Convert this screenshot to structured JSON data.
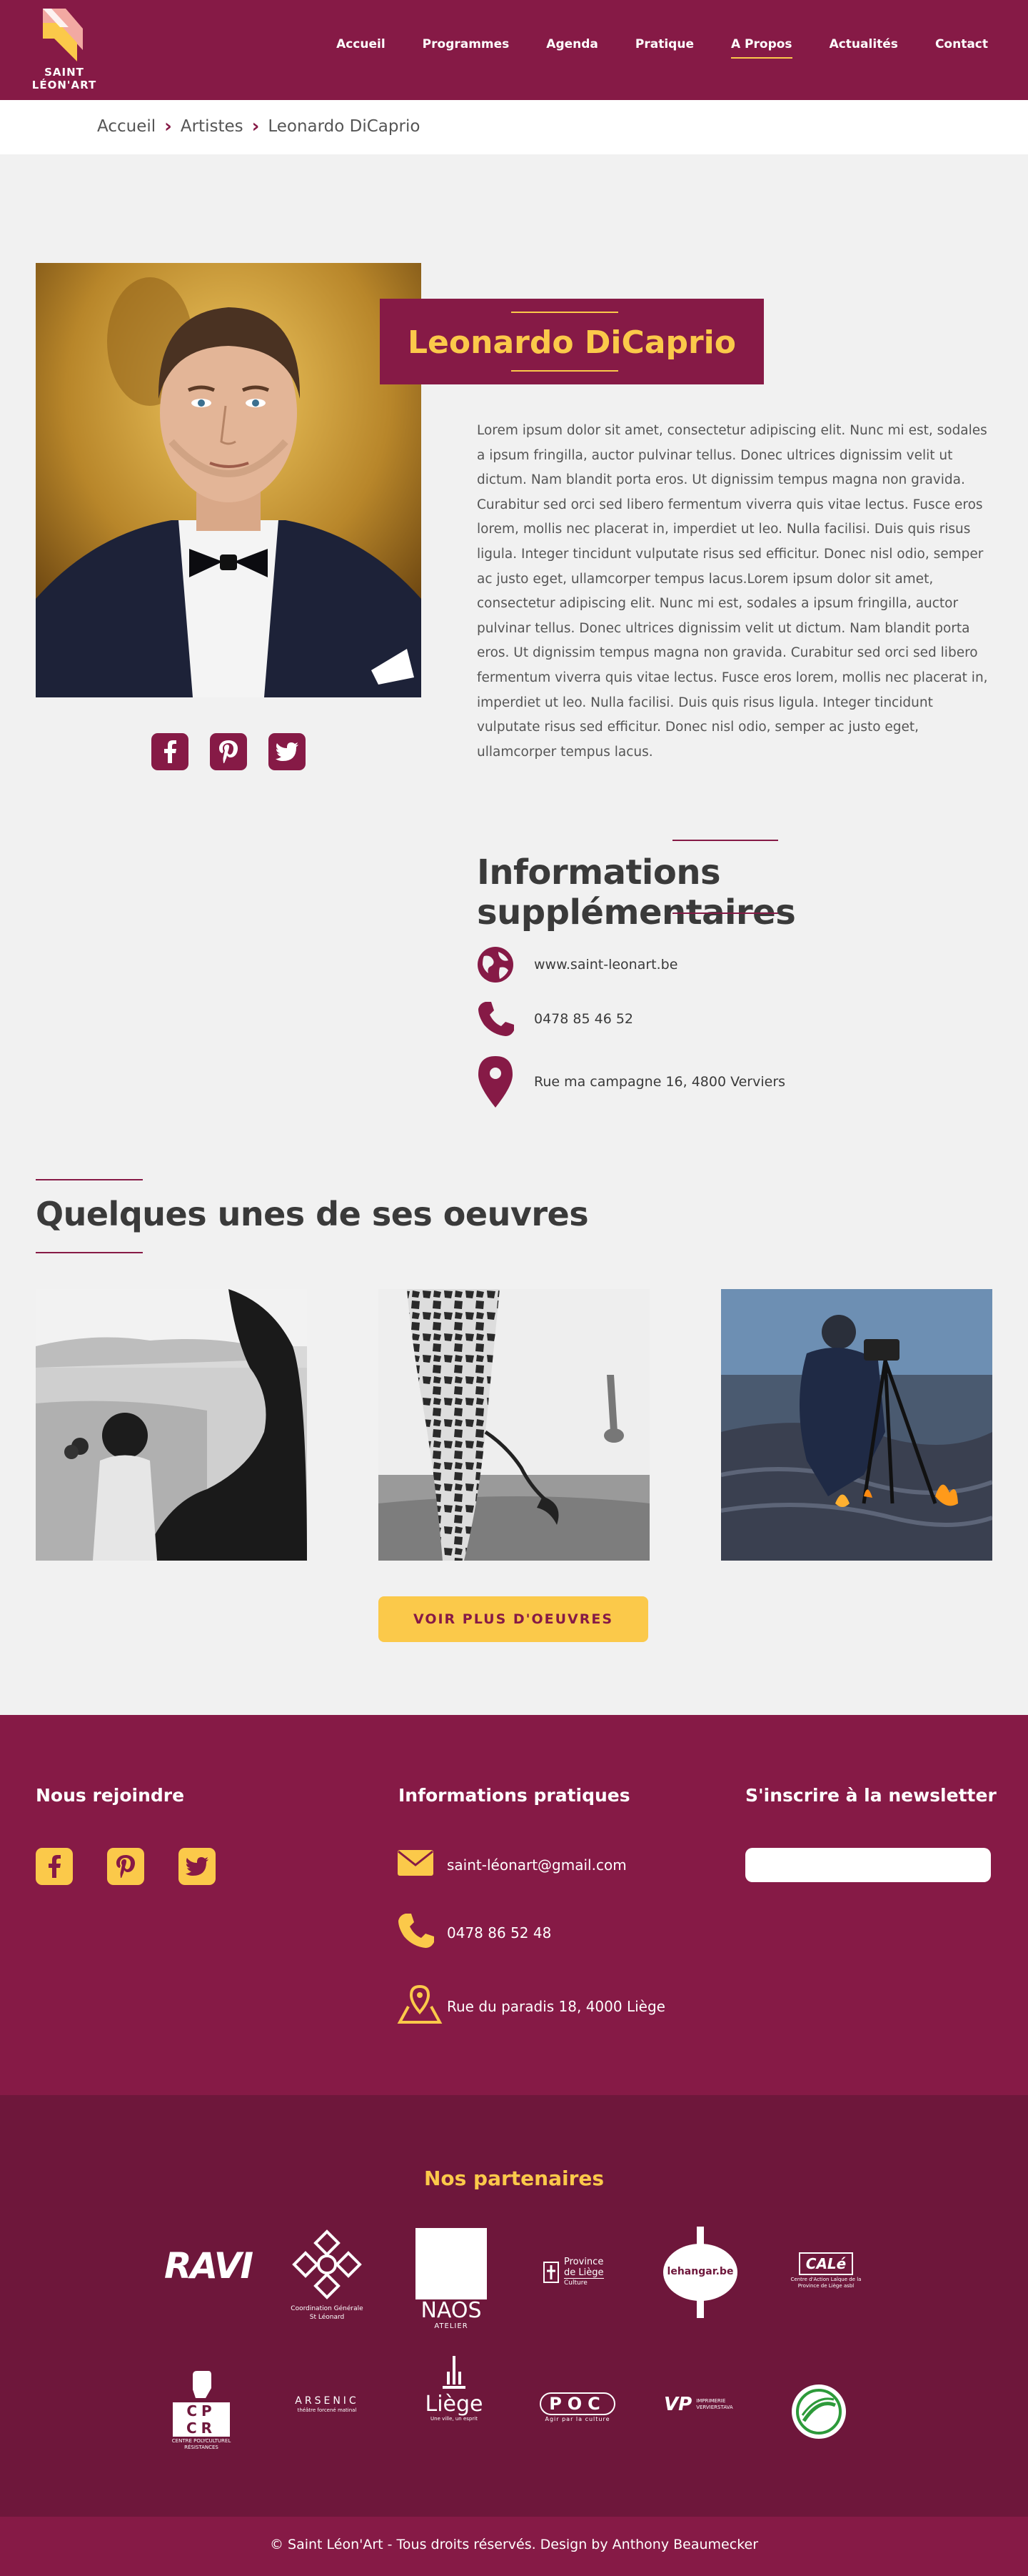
{
  "header": {
    "logo_line1": "SAINT",
    "logo_line2": "LÉON'ART",
    "nav": [
      "Accueil",
      "Programmes",
      "Agenda",
      "Pratique",
      "A Propos",
      "Actualités",
      "Contact"
    ],
    "active_nav": "A Propos"
  },
  "breadcrumb": [
    "Accueil",
    "Artistes",
    "Leonardo DiCaprio"
  ],
  "artist": {
    "name": "Leonardo DiCaprio",
    "bio": "Lorem ipsum dolor sit amet, consectetur adipiscing elit. Nunc mi est, sodales a ipsum fringilla, auctor pulvinar tellus. Donec ultrices dignissim velit ut dictum. Nam blandit porta eros. Ut dignissim tempus magna non gravida. Curabitur sed orci sed libero fermentum viverra quis vitae lectus. Fusce eros lorem, mollis nec placerat in, imperdiet ut leo. Nulla facilisi. Duis quis risus ligula. Integer tincidunt vulputate risus sed efficitur. Donec nisl odio, semper ac justo eget, ullamcorper tempus lacus.Lorem ipsum dolor sit amet, consectetur adipiscing elit. Nunc mi est, sodales a ipsum fringilla, auctor pulvinar tellus. Donec ultrices dignissim velit ut dictum. Nam blandit porta eros. Ut dignissim tempus magna non gravida. Curabitur sed orci sed libero fermentum viverra quis vitae lectus. Fusce eros lorem, mollis nec placerat in, imperdiet ut leo. Nulla facilisi. Duis quis risus ligula. Integer tincidunt vulputate risus sed efficitur. Donec nisl odio, semper ac justo eget, ullamcorper tempus lacus.",
    "social_icons": [
      "facebook-icon",
      "pinterest-icon",
      "twitter-icon"
    ]
  },
  "infos": {
    "title": "Informations supplémentaires",
    "website": "www.saint-leonart.be",
    "phone": "0478 85 46 52",
    "address": "Rue ma campagne 16, 4800 Verviers"
  },
  "oeuvres": {
    "title": "Quelques unes de ses oeuvres",
    "button": "VOIR PLUS D'OEUVRES"
  },
  "footer": {
    "join_title": "Nous rejoindre",
    "practical_title": "Informations pratiques",
    "newsletter_title": "S'inscrire à la newsletter",
    "email": "saint-léonart@gmail.com",
    "phone": "0478 86 52 48",
    "address": "Rue du paradis 18, 4000 Liège",
    "newsletter_placeholder": ""
  },
  "partners": {
    "title": "Nos partenaires",
    "logos": {
      "ravi": "RAVI",
      "coord_line1": "Coordination Générale",
      "coord_line2": "St Léonard",
      "naos": "NAOS",
      "naos_sub": "ATELIER",
      "province_line1": "Province",
      "province_line2": "de Liège",
      "province_sub": "Culture",
      "hangar": "lehangar.be",
      "cale": "CALé",
      "cale_sub": "Centre d'Action Laïque de la Province de Liège asbl",
      "cpcr": "CP CR",
      "cpcr_sub": "CENTRE POLYCULTUREL RÉSISTANCES",
      "arsenic": "ARSENIC",
      "arsenic_sub": "théâtre forcené matinal",
      "liege": "Liège",
      "liege_sub": "Une ville, un esprit",
      "poc": "POC",
      "poc_sub": "Agir par la culture",
      "vp": "VP",
      "vp_sub": "IMPRIMERIE VERVIERSTAVA"
    }
  },
  "copyright": "© Saint Léon'Art - Tous droits réservés. Design by Anthony Beaumecker",
  "colors": {
    "brand": "#861a46",
    "accent": "#fbc94a",
    "partners_bg": "#6e173b"
  }
}
